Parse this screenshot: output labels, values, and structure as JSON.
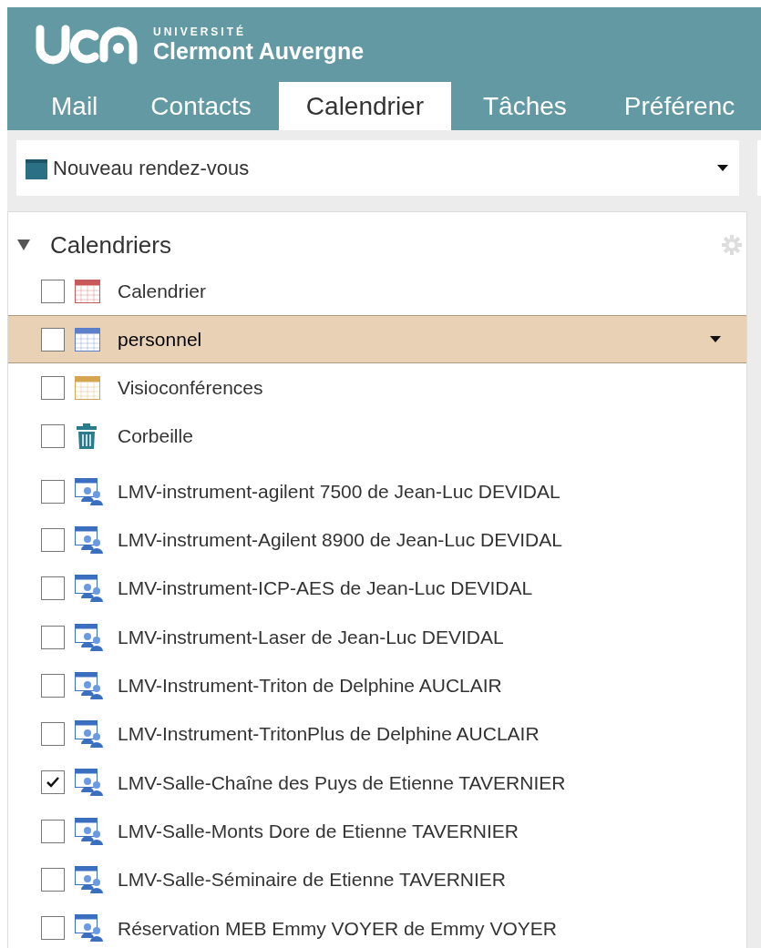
{
  "header": {
    "logo_small": "UNIVERSITÉ",
    "logo_name": "Clermont Auvergne"
  },
  "tabs": [
    {
      "label": "Mail",
      "selected": false
    },
    {
      "label": "Contacts",
      "selected": false
    },
    {
      "label": "Calendrier",
      "selected": true
    },
    {
      "label": "Tâches",
      "selected": false
    },
    {
      "label": "Préférenc",
      "selected": false
    }
  ],
  "toolbar": {
    "new_button": "Nouveau rendez-vous"
  },
  "sidebar": {
    "title": "Calendriers",
    "expanded": true,
    "items": [
      {
        "kind": "calendar",
        "label": "Calendrier",
        "checked": false,
        "selected": false,
        "color": "#c9585b"
      },
      {
        "kind": "calendar",
        "label": "personnel",
        "checked": false,
        "selected": true,
        "color": "#5b7fc9"
      },
      {
        "kind": "calendar",
        "label": "Visioconférences",
        "checked": false,
        "selected": false,
        "color": "#d6a552"
      },
      {
        "kind": "trash",
        "label": "Corbeille",
        "checked": false,
        "selected": false
      },
      {
        "kind": "shared",
        "label": "LMV-instrument-agilent 7500 de Jean-Luc DEVIDAL",
        "checked": false,
        "selected": false
      },
      {
        "kind": "shared",
        "label": "LMV-instrument-Agilent 8900 de Jean-Luc DEVIDAL",
        "checked": false,
        "selected": false
      },
      {
        "kind": "shared",
        "label": "LMV-instrument-ICP-AES de Jean-Luc DEVIDAL",
        "checked": false,
        "selected": false
      },
      {
        "kind": "shared",
        "label": "LMV-instrument-Laser de Jean-Luc DEVIDAL",
        "checked": false,
        "selected": false
      },
      {
        "kind": "shared",
        "label": "LMV-Instrument-Triton de Delphine AUCLAIR",
        "checked": false,
        "selected": false
      },
      {
        "kind": "shared",
        "label": "LMV-Instrument-TritonPlus de Delphine AUCLAIR",
        "checked": false,
        "selected": false
      },
      {
        "kind": "shared",
        "label": "LMV-Salle-Chaîne des Puys de Etienne TAVERNIER",
        "checked": true,
        "selected": false
      },
      {
        "kind": "shared",
        "label": "LMV-Salle-Monts Dore de Etienne TAVERNIER",
        "checked": false,
        "selected": false
      },
      {
        "kind": "shared",
        "label": "LMV-Salle-Séminaire de Etienne TAVERNIER",
        "checked": false,
        "selected": false
      },
      {
        "kind": "shared",
        "label": "Réservation MEB Emmy VOYER de Emmy VOYER",
        "checked": false,
        "selected": false
      }
    ]
  }
}
